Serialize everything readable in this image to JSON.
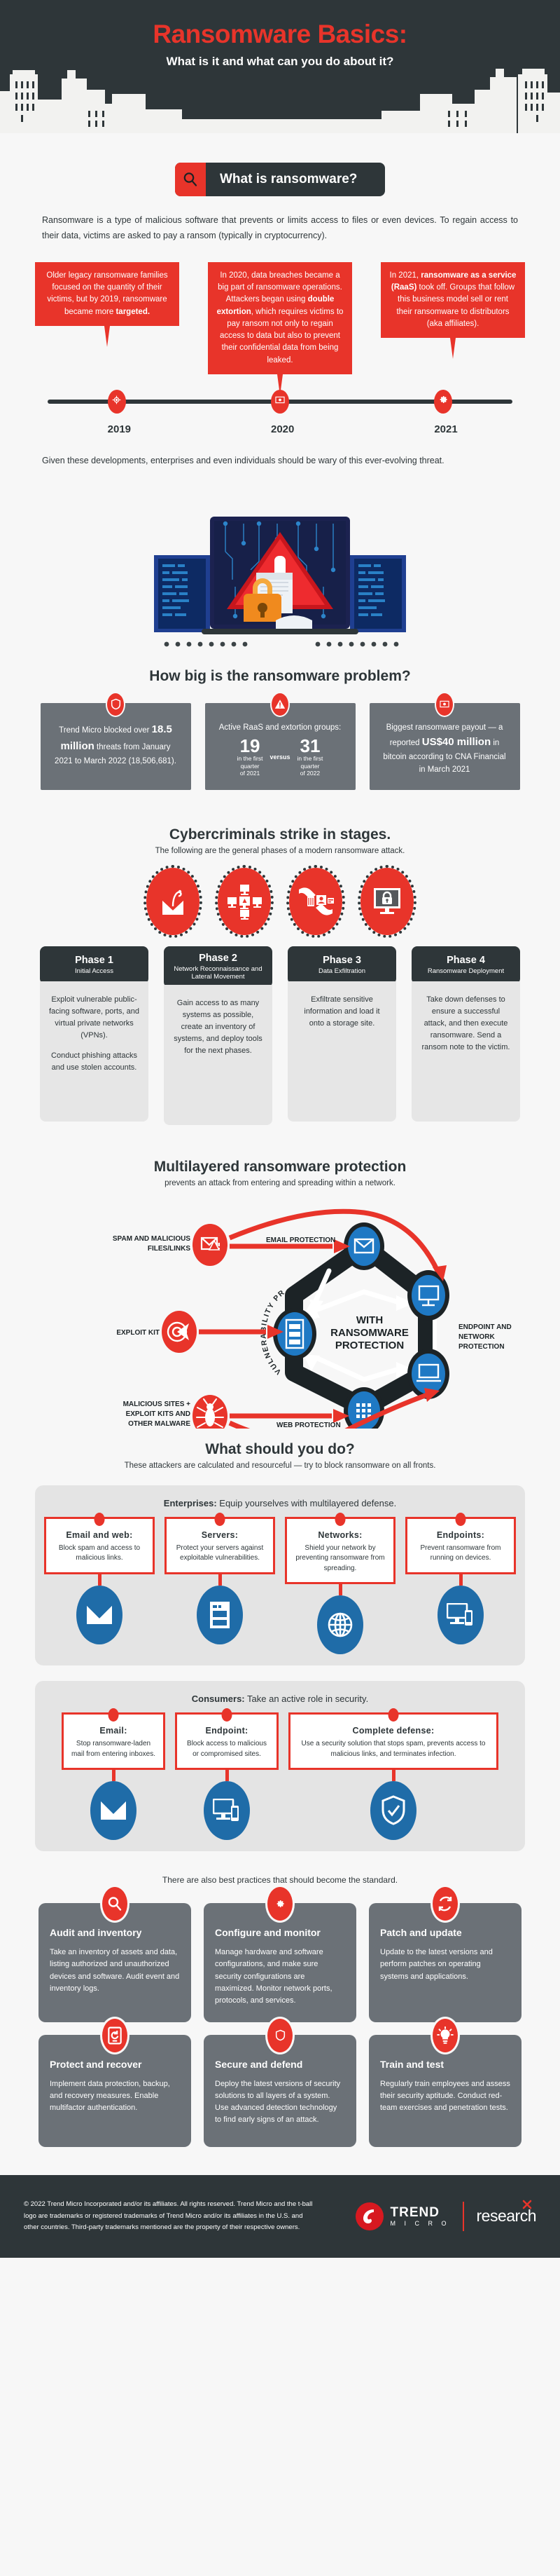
{
  "header": {
    "title": "Ransomware Basics:",
    "subtitle": "What is it and what can you do about it?",
    "bg_color": "#2e3639",
    "accent_color": "#e8342a"
  },
  "section_what_is": {
    "banner_label": "What is ransomware?",
    "banner_icon": "search-icon",
    "paragraph": "Ransomware is a type of malicious software that prevents or limits access to files or even devices. To regain access to their data, victims are asked to pay a ransom (typically in cryptocurrency).",
    "closing_note": "Given these developments, enterprises and even individuals should be wary of this ever-evolving threat."
  },
  "timeline": {
    "items": [
      {
        "year": "2019",
        "icon": "target-icon",
        "text_parts": [
          {
            "t": "Older legacy ransomware families focused on the quantity of their victims, but by 2019, ransomware became more ",
            "b": false
          },
          {
            "t": "targeted.",
            "b": true
          }
        ]
      },
      {
        "year": "2020",
        "icon": "banknote-icon",
        "text_parts": [
          {
            "t": "In 2020, data breaches became a big part of ransomware operations. Attackers began using ",
            "b": false
          },
          {
            "t": "double extortion",
            "b": true
          },
          {
            "t": ", which requires victims to pay ransom not only to regain access to data but also to prevent their confidential data from being leaked.",
            "b": false
          }
        ]
      },
      {
        "year": "2021",
        "icon": "gear-icon",
        "text_parts": [
          {
            "t": "In 2021, ",
            "b": false
          },
          {
            "t": "ransomware as a service (RaaS)",
            "b": true
          },
          {
            "t": " took off. Groups that follow this business model sell or rent their ransomware to distributors (aka affiliates).",
            "b": false
          }
        ]
      }
    ]
  },
  "how_big": {
    "title": "How big is the ransomware problem?",
    "stats": [
      {
        "icon": "shield-icon",
        "type": "text",
        "parts": [
          {
            "t": "Trend Micro blocked over ",
            "b": false
          },
          {
            "t": "18.5 million",
            "b": true
          },
          {
            "t": " threats from January 2021 to March 2022 (18,506,681).",
            "b": false
          }
        ]
      },
      {
        "icon": "warning-icon",
        "type": "versus",
        "lead": "Active RaaS and extortion groups:",
        "left_number": "19",
        "left_caption": "in the first quarter of 2021",
        "versus_label": "versus",
        "right_number": "31",
        "right_caption": "in the first quarter of 2022"
      },
      {
        "icon": "banknote-icon",
        "type": "text",
        "parts": [
          {
            "t": "Biggest ransomware payout — a reported ",
            "b": false
          },
          {
            "t": "US$40 million",
            "b": true
          },
          {
            "t": " in bitcoin according to CNA Financial in March 2021",
            "b": false
          }
        ]
      }
    ]
  },
  "stages": {
    "title": "Cybercriminals strike in stages.",
    "subtitle": "The following are the general phases of a modern ransomware attack.",
    "phases": [
      {
        "icon": "phishing-hook-email-icon",
        "number": "Phase 1",
        "name": "Initial Access",
        "paragraphs": [
          "Exploit vulnerable public-facing software, ports, and virtual private networks (VPNs).",
          "Conduct phishing attacks and use stolen accounts."
        ]
      },
      {
        "icon": "network-systems-icon",
        "number": "Phase 2",
        "name": "Network Reconnaissance and Lateral Movement",
        "paragraphs": [
          "Gain access to as many systems as possible, create an inventory of systems, and deploy tools for the next phases."
        ]
      },
      {
        "icon": "data-theft-hand-icon",
        "number": "Phase 3",
        "name": "Data Exfiltration",
        "paragraphs": [
          "Exfiltrate sensitive information and load it onto a storage site."
        ]
      },
      {
        "icon": "locked-monitor-icon",
        "number": "Phase 4",
        "name": "Ransomware Deployment",
        "paragraphs": [
          "Take down defenses to ensure a successful attack, and then execute ransomware. Send a ransom note to the victim."
        ]
      }
    ]
  },
  "multilayer": {
    "title": "Multilayered ransomware protection",
    "subtitle": "prevents an attack from entering and spreading within a network.",
    "center_label": "WITH RANSOMWARE PROTECTION",
    "threats": [
      {
        "label": "SPAM AND MALICIOUS FILES/LINKS",
        "icon": "spam-envelope-icon"
      },
      {
        "label": "EXPLOIT KIT",
        "icon": "exploit-target-icon"
      },
      {
        "label": "MALICIOUS SITES + EXPLOIT KITS AND OTHER MALWARE",
        "icon": "bug-icon"
      }
    ],
    "layer_labels": [
      "EMAIL PROTECTION",
      "VULNERABILITY PROTECTION",
      "WEB PROTECTION",
      "ENDPOINT AND NETWORK PROTECTION"
    ],
    "nodes": [
      {
        "icon": "email-node-icon"
      },
      {
        "icon": "server-node-icon"
      },
      {
        "icon": "web-grid-node-icon"
      },
      {
        "icon": "desktop-node-icon"
      },
      {
        "icon": "laptop-node-icon"
      }
    ]
  },
  "what_to_do": {
    "title": "What should you do?",
    "subtitle": "These attackers are calculated and resourceful — try to block ransomware on all fronts.",
    "enterprises": {
      "head_bold": "Enterprises:",
      "head_rest": " Equip yourselves with multilayered defense.",
      "cards": [
        {
          "title": "Email and web:",
          "text": "Block spam and access to malicious links.",
          "icon": "envelope-icon"
        },
        {
          "title": "Servers:",
          "text": "Protect your servers against exploitable vulnerabilities.",
          "icon": "server-icon"
        },
        {
          "title": "Networks:",
          "text": "Shield your network by preventing ransomware from spreading.",
          "icon": "globe-network-icon"
        },
        {
          "title": "Endpoints:",
          "text": "Prevent ransomware from running on devices.",
          "icon": "devices-icon"
        }
      ]
    },
    "consumers": {
      "head_bold": "Consumers:",
      "head_rest": " Take an active role in security.",
      "cards": [
        {
          "title": "Email:",
          "text": "Stop ransomware-laden mail from entering inboxes.",
          "icon": "envelope-icon"
        },
        {
          "title": "Endpoint:",
          "text": "Block access to malicious or compromised sites.",
          "icon": "devices-icon"
        },
        {
          "title": "Complete defense:",
          "text": "Use a security solution that stops spam, prevents access to malicious links, and terminates infection.",
          "icon": "shield-check-icon"
        }
      ]
    }
  },
  "best_practices": {
    "note": "There are also best practices that should become the standard.",
    "items": [
      {
        "icon": "magnifier-icon",
        "title": "Audit and inventory",
        "text": "Take an inventory of assets and data, listing authorized and unauthorized devices and software. Audit event and inventory logs."
      },
      {
        "icon": "gear-icon",
        "title": "Configure and monitor",
        "text": "Manage hardware and software configurations, and make sure security configurations are maximized. Monitor network ports, protocols, and services."
      },
      {
        "icon": "refresh-icon",
        "title": "Patch and update",
        "text": "Update to the latest versions and perform patches on operating systems and applications."
      },
      {
        "icon": "backup-restore-icon",
        "title": "Protect and recover",
        "text": "Implement data protection, backup, and recovery measures. Enable multifactor authentication."
      },
      {
        "icon": "shield-icon",
        "title": "Secure and defend",
        "text": "Deploy the latest versions of security solutions to all layers of a system. Use advanced detection technology to find early signs of an attack."
      },
      {
        "icon": "lightbulb-icon",
        "title": "Train and test",
        "text": "Regularly train employees and assess their security aptitude. Conduct red-team exercises and penetration tests."
      }
    ]
  },
  "footer": {
    "copyright": "© 2022 Trend Micro Incorporated and/or its affiliates. All rights reserved. Trend Micro and the t-ball logo are trademarks or registered trademarks of Trend Micro and/or its affiliates in the U.S. and other countries. Third-party trademarks mentioned are the property of their respective owners.",
    "logo_trend": "TREND",
    "logo_micro": "M I C R O",
    "logo_research": "research"
  }
}
